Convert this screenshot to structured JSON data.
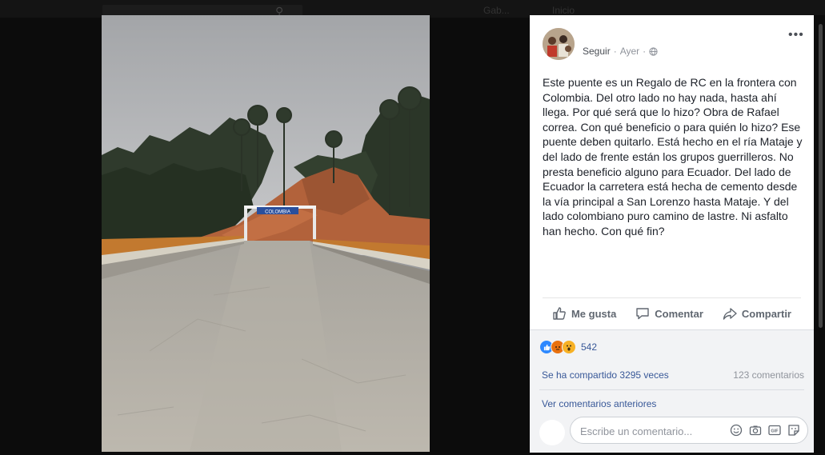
{
  "header": {
    "nav_ghost_1": "Gab...",
    "nav_ghost_2": "Inicio"
  },
  "post": {
    "author_name": "",
    "follow_label": "Seguir",
    "separator": "·",
    "timestamp": "Ayer",
    "privacy_icon": "globe-icon",
    "more_icon": "more-options-icon",
    "text": "Este puente es un Regalo de RC en la frontera con Colombia. Del otro lado no hay nada, hasta ahí llega. Por qué será que lo hizo? Obra de Rafael correa. Con qué beneficio o para quién lo hizo? Ese puente deben quitarlo. Está hecho en el ría Mataje y del lado de frente están los grupos guerrilleros. No presta beneficio alguno para Ecuador. Del lado de Ecuador la carretera está hecha de cemento desde la vía principal a San Lorenzo hasta Mataje. Y del lado colombiano puro camino de lastre. Ni asfalto han hecho. Con qué fin?"
  },
  "photo": {
    "sign_text": "COLOMBIA"
  },
  "actions": {
    "like_label": "Me gusta",
    "comment_label": "Comentar",
    "share_label": "Compartir"
  },
  "stats": {
    "reaction_count": "542",
    "reaction_types": [
      "like",
      "angry",
      "wow"
    ],
    "shares_label": "Se ha compartido 3295 veces",
    "comments_label": "123 comentarios",
    "previous_comments_label": "Ver comentarios anteriores"
  },
  "composer": {
    "placeholder": "Escribe un comentario...",
    "icons": [
      "emoji-icon",
      "camera-icon",
      "gif-icon",
      "sticker-icon"
    ]
  },
  "colors": {
    "link": "#385898",
    "muted": "#90949c",
    "like_blue": "#2d88ff",
    "angry_orange": "#e9710f",
    "wow_yellow": "#f7b125"
  }
}
